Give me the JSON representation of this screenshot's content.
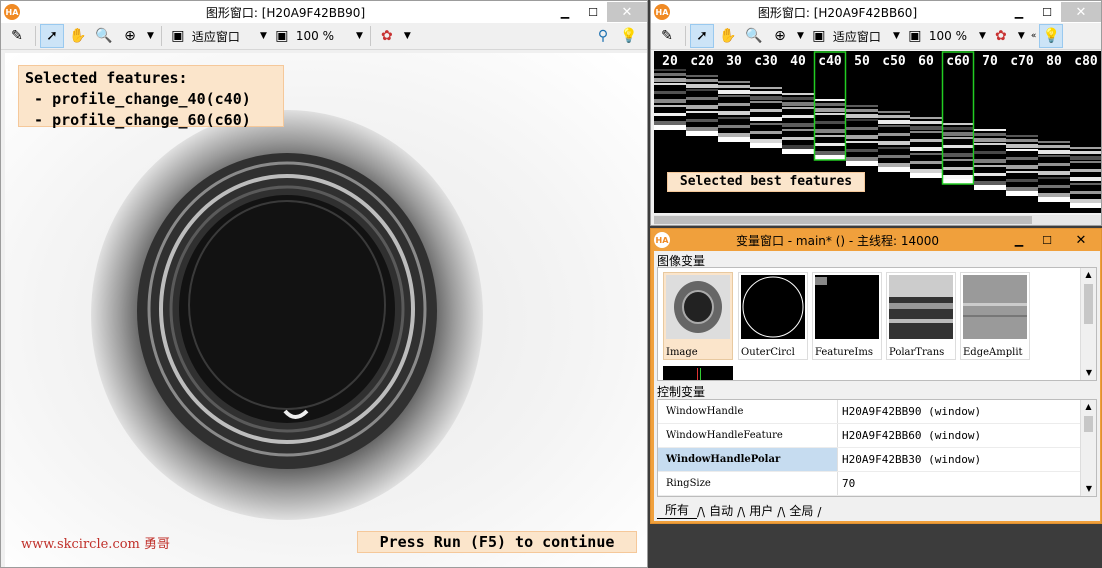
{
  "left_window": {
    "title": "图形窗口: [H20A9F42BB90]",
    "zoom_mode": "适应窗口",
    "zoom_pct": "100 %",
    "overlay": {
      "heading": "Selected features:",
      "items": [
        " - profile_change_40(c40)",
        " - profile_change_60(c60)"
      ]
    },
    "press_run": "Press Run (F5) to continue",
    "watermark": "www.skcircle.com 勇哥"
  },
  "right_window": {
    "title": "图形窗口: [H20A9F42BB60]",
    "zoom_mode": "适应窗口",
    "zoom_pct": "100 %",
    "feature_labels": [
      "20",
      "c20",
      "30",
      "c30",
      "40",
      "c40",
      "50",
      "c50",
      "60",
      "c60",
      "70",
      "c70",
      "80",
      "c80"
    ],
    "highlighted": [
      "c40",
      "c60"
    ],
    "caption": "Selected best features"
  },
  "var_window": {
    "title": "变量窗口 - main* () - 主线程: 14000",
    "iconic_label": "图像变量",
    "iconic": [
      "Image",
      "OuterCircl",
      "FeatureIms",
      "PolarTrans",
      "EdgeAmplit"
    ],
    "control_label": "控制变量",
    "control": [
      {
        "name": "WindowHandle",
        "value": "H20A9F42BB90 (window)"
      },
      {
        "name": "WindowHandleFeature",
        "value": "H20A9F42BB60 (window)"
      },
      {
        "name": "WindowHandlePolar",
        "value": "H20A9F42BB30 (window)"
      },
      {
        "name": "RingSize",
        "value": "70"
      }
    ],
    "tabs": [
      "所有",
      "自动",
      "用户",
      "全局"
    ]
  },
  "colors": {
    "accent": "#f0a03c",
    "highlight_border": "#22cc22",
    "label_bg": "#fbe5cb",
    "selected_row": "#c6dcf0"
  }
}
